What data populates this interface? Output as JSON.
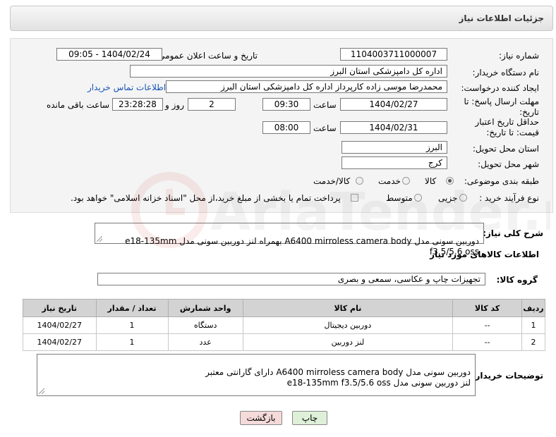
{
  "header": {
    "title": "جزئیات اطلاعات نیاز"
  },
  "form": {
    "need_number_label": "شماره نیاز:",
    "need_number": "1104003711000007",
    "announce_label": "تاریخ و ساعت اعلان عمومی:",
    "announce_value": "1404/02/24 - 09:05",
    "buyer_org_label": "نام دستگاه خریدار:",
    "buyer_org": "اداره کل دامپزشکی استان البرز",
    "creator_label": "ایجاد کننده درخواست:",
    "creator": "محمدرضا موسی زاده کارپرداز اداره کل دامپزشکی استان البرز",
    "contact_link": "اطلاعات تماس خریدار",
    "deadline_label": "مهلت ارسال پاسخ: تا تاریخ:",
    "deadline_date": "1404/02/27",
    "time_label": "ساعت",
    "deadline_time": "09:30",
    "days_value": "2",
    "days_label": "روز و",
    "remaining_value": "23:28:28",
    "remaining_label": "ساعت باقی مانده",
    "validity_label": "حداقل تاریخ اعتبار قیمت: تا تاریخ:",
    "validity_date": "1404/02/31",
    "validity_time": "08:00",
    "province_label": "استان محل تحویل:",
    "province": "البرز",
    "city_label": "شهر محل تحویل:",
    "city": "کرج",
    "category_label": "طبقه بندی موضوعی:",
    "category_options": [
      "کالا",
      "خدمت",
      "کالا/خدمت"
    ],
    "process_label": "نوع فرآیند خرید :",
    "process_options": [
      "جزیی",
      "متوسط"
    ],
    "payment_note": "پرداخت تمام یا بخشی از مبلغ خرید،از محل \"اسناد خزانه اسلامی\" خواهد بود."
  },
  "summary": {
    "label": "شرح کلی نیاز:",
    "text": "دوربین سونی مدل A6400 mirroless camera body بهمراه لنز دوربین سونی مدل e18-135mm f3.5/5.6 oss"
  },
  "goods": {
    "section_title": "اطلاعات کالاهای مورد نیاز",
    "group_label": "گروه کالا:",
    "group_value": "تجهیزات چاپ و عکاسی، سمعی و بصری",
    "columns": [
      "ردیف",
      "کد کالا",
      "نام کالا",
      "واحد شمارش",
      "تعداد / مقدار",
      "تاریخ نیاز"
    ],
    "rows": [
      [
        "1",
        "--",
        "دوربین دیجیتال",
        "دستگاه",
        "1",
        "1404/02/27"
      ],
      [
        "2",
        "--",
        "لنز دوربین",
        "عدد",
        "1",
        "1404/02/27"
      ]
    ]
  },
  "buyer_notes": {
    "label": "توضیحات خریدار:",
    "text": "دوربین سونی مدل A6400 mirroless camera body دارای گارانتی معتبر\nلنز دوربین سونی مدل  e18-135mm f3.5/5.6 oss"
  },
  "buttons": {
    "print": "چاپ",
    "back": "بازگشت"
  },
  "watermark": {
    "text": "AriaTender.neT"
  },
  "colors": {
    "back_button": "#f5dada",
    "print_button": "#dff0d8",
    "link": "#1a55b5",
    "watermark": "#c0392b"
  }
}
